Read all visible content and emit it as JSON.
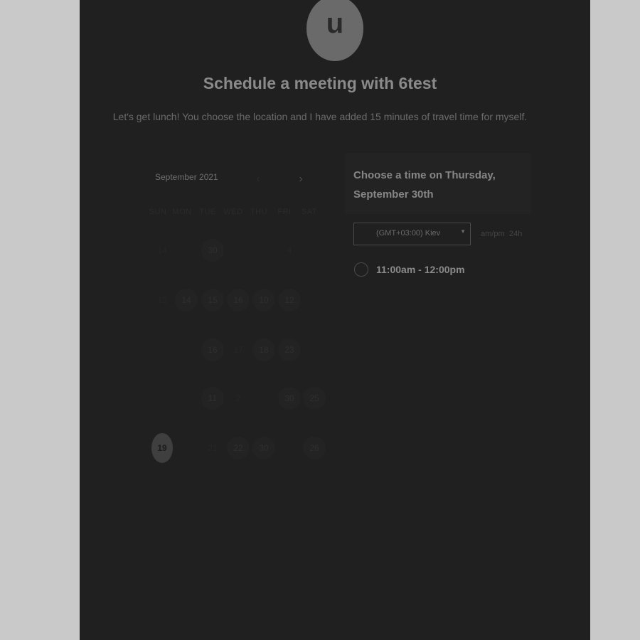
{
  "avatar": {
    "initial": "u"
  },
  "header": {
    "title": "Schedule a meeting with 6test",
    "description": "Let's get lunch! You choose the location and I have added 15 minutes of travel time for myself."
  },
  "calendar": {
    "month_label": "September 2021",
    "prev_icon": "chevron-left-icon",
    "next_icon": "chevron-right-icon",
    "weekdays": [
      "SUN",
      "MON",
      "TUE",
      "WED",
      "THU",
      "FRI",
      "SAT"
    ],
    "selected_day": "19",
    "days": [
      "14",
      "30",
      "4",
      "13",
      "14",
      "15",
      "16",
      "10",
      "12",
      "16",
      "17",
      "18",
      "23",
      "11",
      "2",
      "30",
      "25",
      "19",
      "21",
      "22",
      "30",
      "26"
    ]
  },
  "time_panel": {
    "heading_line1": "Choose a time on Thursday,",
    "heading_line2": "September 30th",
    "timezone": "(GMT+03:00) Kiev",
    "dropdown_icon": "caret-down-icon",
    "format_ampm": "am/pm",
    "format_24h": "24h",
    "slots": [
      "11:00am - 12:00pm"
    ]
  }
}
